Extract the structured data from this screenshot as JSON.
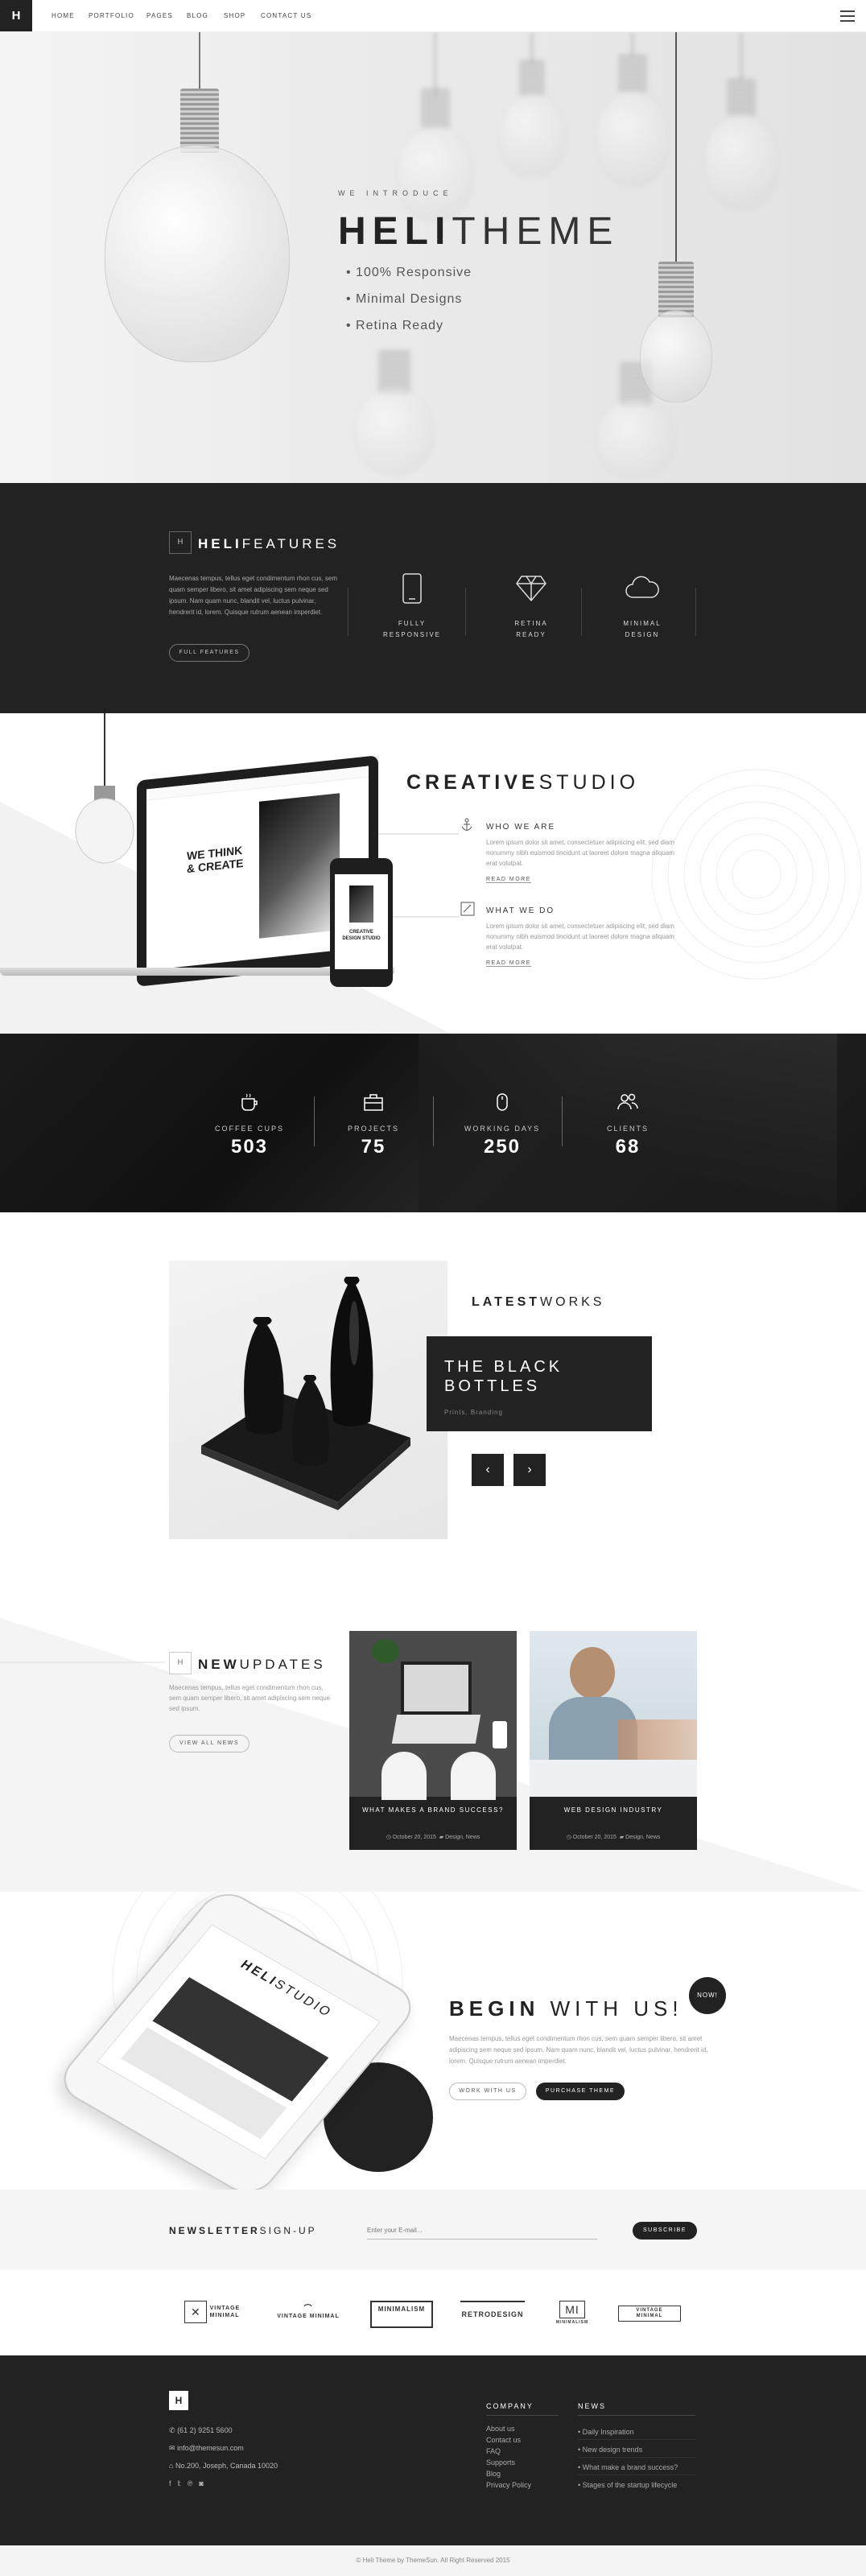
{
  "nav": {
    "logo": "H",
    "links": [
      "HOME",
      "PORTFOLIO",
      "PAGES",
      "BLOG",
      "SHOP",
      "CONTACT US"
    ]
  },
  "hero": {
    "kicker": "WE INTRODUCE",
    "title_bold": "HELI",
    "title_light": "THEME",
    "bullets": [
      "• 100% Responsive",
      "• Minimal Designs",
      "• Retina Ready"
    ]
  },
  "features": {
    "title_bold": "HELI",
    "title_light": "FEATURES",
    "description": "Maecenas tempus, tellus eget condimentum rhon cus, sem quam semper libero, sit amet adipiscing sem neque sed ipsum. Nam quam nunc, blandit vel, luctus pulvinar, hendrerit id, lorem. Quisque rutrum aenean imperdiet.",
    "button": "FULL FEATURES",
    "items": [
      {
        "icon": "mobile-icon",
        "line1": "FULLY",
        "line2": "RESPONSIVE"
      },
      {
        "icon": "diamond-icon",
        "line1": "RETINA",
        "line2": "READY"
      },
      {
        "icon": "cloud-icon",
        "line1": "MINIMAL",
        "line2": "DESIGN"
      }
    ]
  },
  "studio": {
    "title_bold": "CREATIVE",
    "title_light": "STUDIO",
    "blocks": [
      {
        "icon": "anchor-icon",
        "heading": "WHO WE ARE",
        "text": "Lorem ipsum dolor sit amet, consectetuer adipiscing elit, sed diam nonummy nibh euismod tincidunt ut laoreet dolore magna aliquam erat volutpat.",
        "more": "READ MORE"
      },
      {
        "icon": "pencil-icon",
        "heading": "WHAT WE DO",
        "text": "Lorem ipsum dolor sit amet, consectetuer adipiscing elit, sed diam nonummy nibh euismod tincidunt ut laoreet dolore magna aliquam erat volutpat.",
        "more": "READ MORE"
      }
    ],
    "laptop_text_1": "WE THINK",
    "laptop_text_2": "& CREATE",
    "phone_text": "CREATIVE DESIGN STUDIO"
  },
  "stats": [
    {
      "icon": "coffee-icon",
      "label": "COFFEE CUPS",
      "value": "503"
    },
    {
      "icon": "briefcase-icon",
      "label": "PROJECTS",
      "value": "75"
    },
    {
      "icon": "mouse-icon",
      "label": "WORKING DAYS",
      "value": "250"
    },
    {
      "icon": "users-icon",
      "label": "CLIENTS",
      "value": "68"
    }
  ],
  "works": {
    "title_bold": "LATEST",
    "title_light": "WORKS",
    "name_line1": "THE BLACK",
    "name_line2": "BOTTLES",
    "category": "Prints, Branding",
    "prev": "‹",
    "next": "›"
  },
  "updates": {
    "title_bold": "NEW",
    "title_light": "UPDATES",
    "description": "Maecenas tempus, tellus eget condimentum rhon cus, sem quam semper libero, sit amet adipiscing sem neque sed ipsum.",
    "button": "VIEW ALL NEWS",
    "posts": [
      {
        "title": "WHAT MAKES A BRAND SUCCESS?",
        "date": "October 20, 2015",
        "tags": "Design, News"
      },
      {
        "title": "WEB DESIGN INDUSTRY",
        "date": "October 20, 2015",
        "tags": "Design, News"
      }
    ]
  },
  "begin": {
    "title_bold": "BEGIN",
    "title_light": "WITH US!",
    "badge": "NOW!",
    "description": "Maecenas tempus, tellus eget condimentum rhon cus, sem quam semper libero, sit amet adipiscing sem neque sed ipsum. Nam quam nunc, blandit vel, luctus pulvinar, hendrerit id, lorem. Quisque rutrum aenean imperdiet.",
    "btn_outline": "WORK WITH US",
    "btn_dark": "PURCHASE THEME",
    "phone_text_bold": "HELI",
    "phone_text_light": "STUDIO"
  },
  "newsletter": {
    "title_bold": "NEWSLETTER",
    "title_light": "SIGN-UP",
    "placeholder": "Enter your E-mail...",
    "button": "SUBSCRIBE"
  },
  "brands": [
    "VINTAGE MINIMAL",
    "VINTAGE MINIMAL",
    "MINIMALISM",
    "RETRODESIGN",
    "MINIMALISM",
    "VINTAGE MINIMAL"
  ],
  "footer": {
    "logo": "H",
    "phone": "(61 2) 9251 5600",
    "email": "info@themesun.com",
    "address": "No.200, Joseph, Canada 10020",
    "company_head": "COMPANY",
    "company_links": [
      "About us",
      "Contact us",
      "FAQ",
      "Supports",
      "Blog",
      "Privacy Policy"
    ],
    "news_head": "NEWS",
    "news_links": [
      "• Daily Inspiration",
      "• New design trends",
      "• What make a brand success?",
      "• Stages of the startup lifecycle"
    ],
    "copyright": "© Heli Theme by ThemeSun. All Right Reserved 2015"
  },
  "colors": {
    "dark": "#222222",
    "light_bg": "#f5f5f5",
    "accent_text": "#333333"
  }
}
